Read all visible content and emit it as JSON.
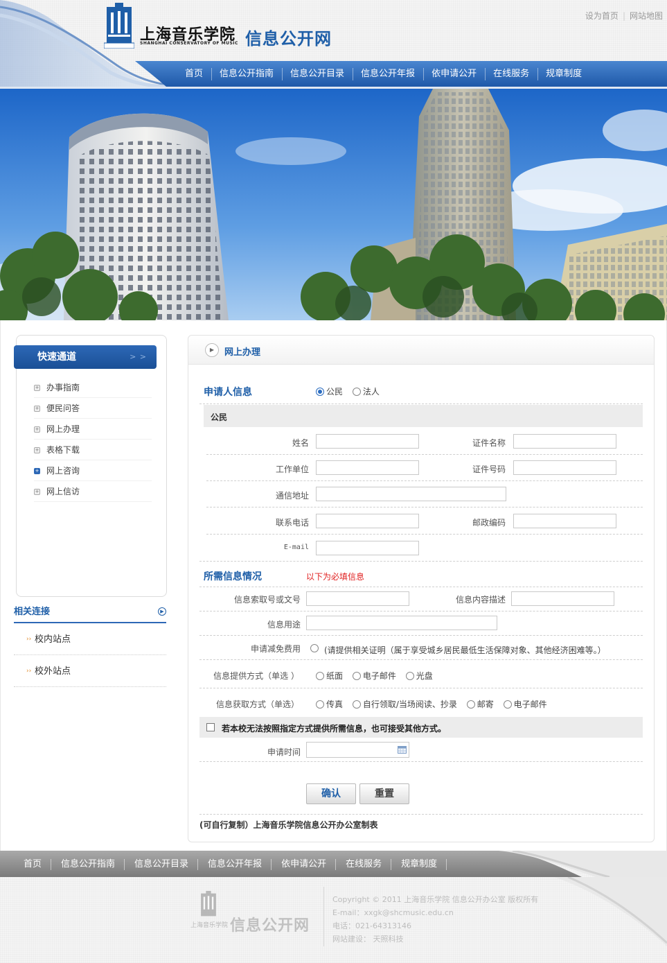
{
  "header": {
    "logo_cn": "上海音乐学院",
    "logo_en": "SHANGHAI CONSERVATORY OF MUSIC",
    "logo_sub": "信息公开网",
    "top_links": [
      "设为首页",
      "网站地图"
    ]
  },
  "nav": [
    "首页",
    "信息公开指南",
    "信息公开目录",
    "信息公开年报",
    "依申请公开",
    "在线服务",
    "规章制度"
  ],
  "sidebar": {
    "quick_title": "快速通道",
    "quick_arrow": "> >",
    "quick_items": [
      "办事指南",
      "便民问答",
      "网上办理",
      "表格下载",
      "网上咨询",
      "网上信访"
    ],
    "related_title": "相关连接",
    "related_items": [
      "校内站点",
      "校外站点"
    ]
  },
  "panel": {
    "title": "网上办理",
    "applicant": {
      "section_title": "申请人信息",
      "types": [
        "公民",
        "法人"
      ],
      "selected_type": "公民",
      "subsection": "公民",
      "fields": {
        "name": "姓名",
        "cert_name": "证件名称",
        "work_unit": "工作单位",
        "cert_no": "证件号码",
        "address": "通信地址",
        "phone": "联系电话",
        "postcode": "邮政编码",
        "email": "E-mail"
      }
    },
    "info": {
      "section_title": "所需信息情况",
      "required_note": "以下为必填信息",
      "index_no": "信息索取号或文号",
      "content_desc": "信息内容描述",
      "usage": "信息用途",
      "fee_reduce": "申请减免费用",
      "fee_note": "(请提供相关证明（属于享受城乡居民最低生活保障对象、其他经济困难等。）",
      "provide_label": "信息提供方式（单选 ）",
      "provide_options": [
        "纸面",
        "电子邮件",
        "光盘"
      ],
      "obtain_label": "信息获取方式（单选）",
      "obtain_options": [
        "传真",
        "自行领取/当场阅读、抄录",
        "邮寄",
        "电子邮件"
      ],
      "other_way": "若本校无法按照指定方式提供所需信息，也可接受其他方式。",
      "apply_time": "申请时间"
    },
    "buttons": {
      "confirm": "确认",
      "reset": "重置"
    },
    "footnote": "(可自行复制）上海音乐学院信息公开办公室制表"
  },
  "footer": {
    "nav": [
      "首页",
      "信息公开指南",
      "信息公开目录",
      "信息公开年报",
      "依申请公开",
      "在线服务",
      "规章制度"
    ],
    "logo_sub": "信息公开网",
    "logo_cn": "上海音乐学院",
    "lines": [
      "Copyright © 2011 上海音乐学院 信息公开办公室 版权所有",
      "E-mail：xxgk@shcmusic.edu.cn",
      "电话：021-64313146",
      "网站建设： 天照科技"
    ]
  },
  "colors": {
    "brand_blue": "#1f5fa8",
    "nav_blue": "#2d68b6",
    "required_red": "#e02020"
  }
}
